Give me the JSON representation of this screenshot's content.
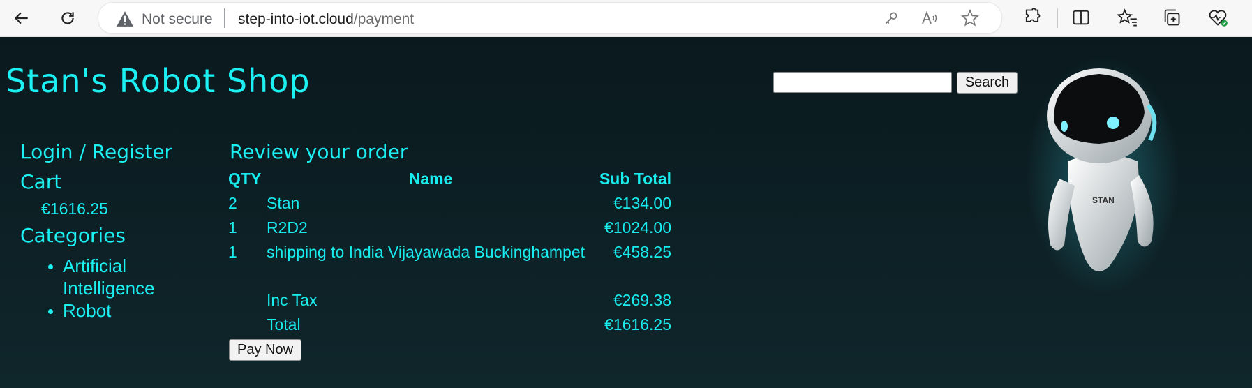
{
  "browser": {
    "security_label": "Not secure",
    "url_host": "step-into-iot.cloud",
    "url_path": "/payment"
  },
  "site": {
    "title": "Stan's Robot Shop",
    "search_button": "Search",
    "search_value": ""
  },
  "sidebar": {
    "login_label": "Login / Register",
    "cart_label": "Cart",
    "cart_total": "€1616.25",
    "categories_label": "Categories",
    "categories": [
      "Artificial Intelligence",
      "Robot"
    ]
  },
  "order": {
    "title": "Review your order",
    "headers": {
      "qty": "QTY",
      "name": "Name",
      "subtotal": "Sub Total"
    },
    "rows": [
      {
        "qty": "2",
        "name": "Stan",
        "subtotal": "€134.00"
      },
      {
        "qty": "1",
        "name": "R2D2",
        "subtotal": "€1024.00"
      },
      {
        "qty": "1",
        "name": "shipping to India Vijayawada Buckinghampet",
        "subtotal": "€458.25"
      }
    ],
    "tax_label": "Inc Tax",
    "tax_value": "€269.38",
    "total_label": "Total",
    "total_value": "€1616.25",
    "pay_button": "Pay Now"
  },
  "robot_badge": "STAN",
  "colors": {
    "accent": "#1cf0f2",
    "background": "#0b1a1f"
  }
}
